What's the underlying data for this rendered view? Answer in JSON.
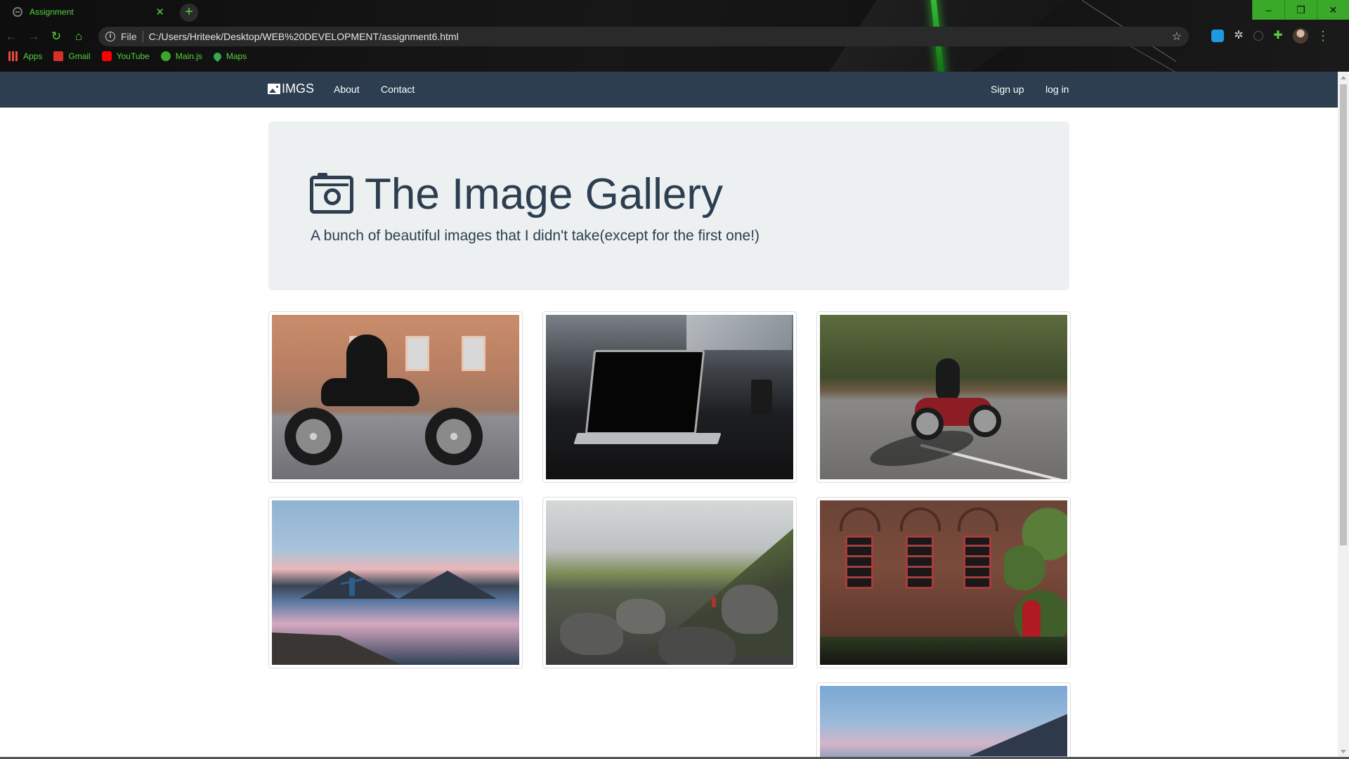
{
  "browser": {
    "tab_title": "Assignment",
    "tab_close": "✕",
    "new_tab": "+",
    "window_controls": {
      "minimize": "–",
      "restore": "❐",
      "close": "✕"
    },
    "nav": {
      "back": "←",
      "forward": "→",
      "reload": "↻",
      "home": "⌂"
    },
    "omnibox": {
      "scheme_label": "File",
      "url": "C:/Users/Hriteek/Desktop/WEB%20DEVELOPMENT/assignment6.html",
      "star": "☆"
    },
    "extensions": [
      "translate-extension-icon",
      "gear-extension-icon",
      "faint-extension-icon",
      "puzzle-extension-icon"
    ],
    "menu": "⋮",
    "bookmarks": [
      {
        "label": "Apps",
        "icon": "apps-grid-icon"
      },
      {
        "label": "Gmail",
        "icon": "gmail-icon"
      },
      {
        "label": "YouTube",
        "icon": "youtube-icon"
      },
      {
        "label": "Main.js",
        "icon": "globe-icon"
      },
      {
        "label": "Maps",
        "icon": "maps-pin-icon"
      }
    ],
    "accent_color": "#56d23b"
  },
  "navbar": {
    "brand": "IMGS",
    "links": [
      "About",
      "Contact"
    ],
    "right_links": [
      "Sign up",
      "log in"
    ],
    "background": "#2c3e50"
  },
  "jumbotron": {
    "title": "The Image Gallery",
    "subtitle": "A bunch of beautiful images that I didn't take(except for the first one!)",
    "icon": "camera-icon"
  },
  "gallery": {
    "images": [
      "motorcycle-rider-city",
      "laptop-on-desk",
      "motorcycle-on-road",
      "person-at-lake-sunset",
      "rocky-valley-hiker",
      "brick-building-ivy",
      "lake-sunset-partial"
    ]
  }
}
